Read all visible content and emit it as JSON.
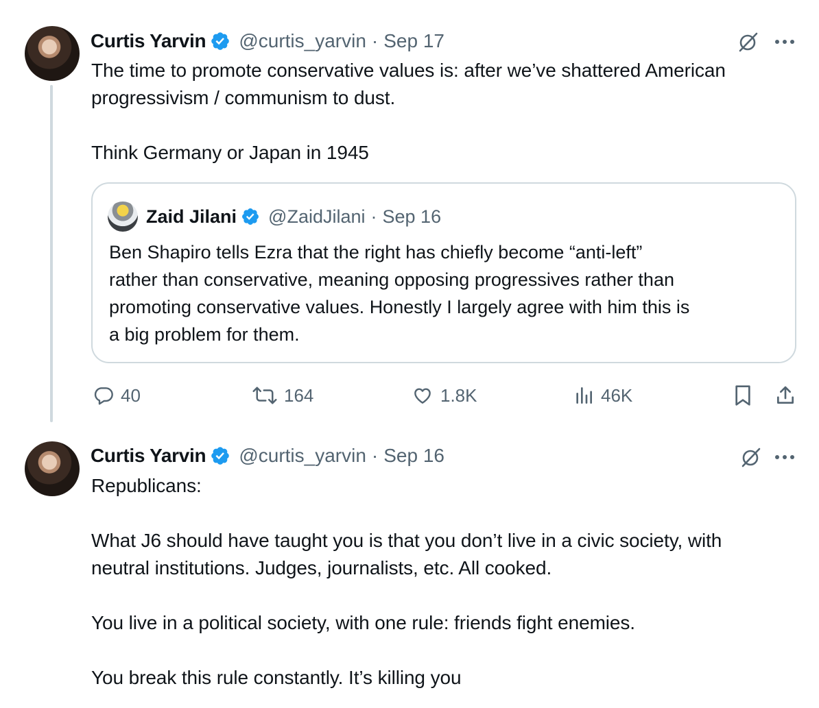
{
  "tweet1": {
    "name": "Curtis Yarvin",
    "handle": "@curtis_yarvin",
    "separator": "·",
    "date": "Sep 17",
    "text": "The time to promote conservative values is: after we’ve shattered American\nprogressivism / communism to dust.\n\nThink Germany or Japan in 1945",
    "quote": {
      "name": "Zaid Jilani",
      "handle": "@ZaidJilani",
      "separator": "·",
      "date": "Sep 16",
      "text": "Ben Shapiro tells Ezra that the right has chiefly become “anti-left”\nrather than conservative, meaning opposing progressives rather than\npromoting conservative values. Honestly I largely agree with him this is\na big problem for them."
    },
    "actions": {
      "replies": "40",
      "retweets": "164",
      "likes": "1.8K",
      "views": "46K"
    }
  },
  "tweet2": {
    "name": "Curtis Yarvin",
    "handle": "@curtis_yarvin",
    "separator": "·",
    "date": "Sep 16",
    "text": "Republicans:\n\nWhat J6 should have taught you is that you don’t live in a civic society, with\nneutral institutions. Judges, journalists, etc. All cooked.\n\nYou live in a political society, with one rule: friends fight enemies.\n\nYou break this rule constantly. It’s killing you"
  },
  "icons": {
    "verified": "verified-badge-icon",
    "grok": "grok-icon",
    "more": "more-icon",
    "reply": "reply-icon",
    "retweet": "retweet-icon",
    "like": "heart-icon",
    "views": "views-icon",
    "bookmark": "bookmark-icon",
    "share": "share-icon"
  },
  "colors": {
    "verified": "#1d9bf0",
    "secondary_text": "#536471",
    "border": "#cfd9de"
  }
}
